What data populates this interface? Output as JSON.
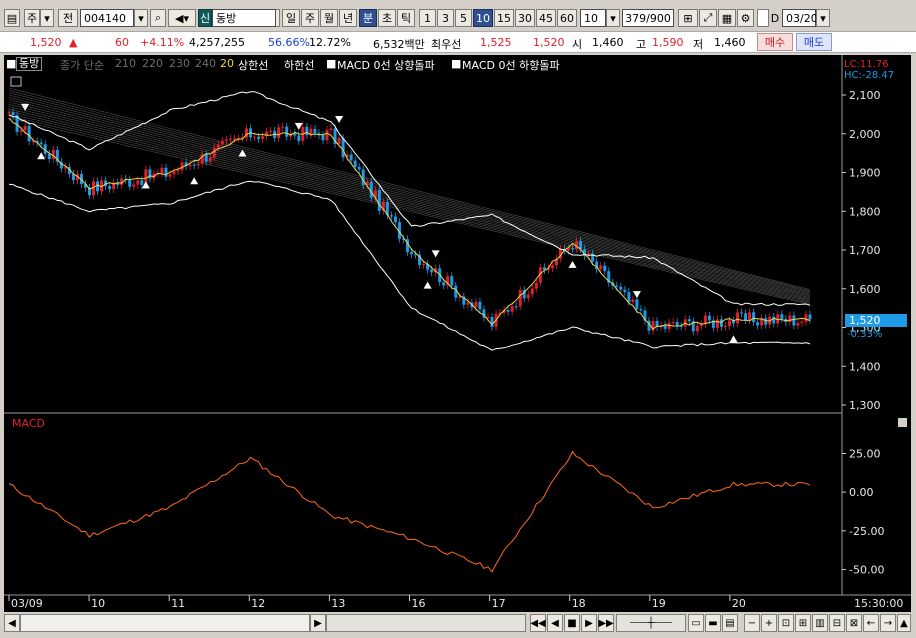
{
  "toolbar": {
    "market": "주",
    "prefix": "전",
    "code": "004140",
    "badge": "신",
    "name": "동방",
    "period_tabs": [
      "일",
      "주",
      "월",
      "년",
      "분",
      "초",
      "틱"
    ],
    "active_period": "분",
    "intervals": [
      "1",
      "3",
      "5",
      "10",
      "15",
      "30",
      "45",
      "60"
    ],
    "active_interval": "10",
    "count_value": "10",
    "page_count": "379/900",
    "date_check_label": "D",
    "date": "03/20"
  },
  "quote": {
    "price": "1,520",
    "arrow": "▲",
    "change": "60",
    "change_pct": "+4.11%",
    "volume": "4,257,255",
    "ratio1": "56.66%",
    "ratio2": "12.72%",
    "amount": "6,532백만",
    "priority_label": "최우선",
    "ask": "1,525",
    "bid": "1,520",
    "open_label": "시",
    "open": "1,460",
    "high_label": "고",
    "high": "1,590",
    "low_label": "저",
    "low": "1,460",
    "buy_label": "매수",
    "sell_label": "매도"
  },
  "legend": {
    "title": "동방",
    "ma_label": "종가 단순",
    "ma_periods": [
      "210",
      "220",
      "230",
      "240"
    ],
    "bb_period": "20",
    "bb_upper": "상한선",
    "bb_lower": "하한선",
    "signal_up": "MACD 0선 상향돌파",
    "signal_down": "MACD 0선 하향돌파",
    "lc": "LC:11.76",
    "hc": "HC:-28.47"
  },
  "price_axis": {
    "ticks": [
      "2,100",
      "2,000",
      "1,900",
      "1,800",
      "1,700",
      "1,600",
      "1,500",
      "1,400",
      "1,300"
    ],
    "current_price": "1,520",
    "current_change": "-0.33%"
  },
  "macd": {
    "title": "MACD",
    "ticks": [
      "25.00",
      "0.00",
      "-25.00",
      "-50.00"
    ]
  },
  "x_axis": {
    "labels": [
      "03/09",
      "10",
      "11",
      "12",
      "13",
      "16",
      "17",
      "18",
      "19",
      "20"
    ],
    "time": "15:30:00"
  },
  "colors": {
    "up": "#e0202a",
    "down": "#1e9be8",
    "bollinger": "#ffffff",
    "ma20": "#e8d84a",
    "macd": "#ff6a1a",
    "grid_ma": "#8a8a8a",
    "price_marker": "#1e9be8"
  },
  "chart_data": {
    "type": "line",
    "x": [
      "03/09",
      "10",
      "11",
      "12",
      "13",
      "16",
      "17",
      "18",
      "19",
      "20"
    ],
    "price_ylim": [
      1300,
      2100
    ],
    "macd_ylim": [
      -60,
      35
    ],
    "x_tick_labels": [
      "03/09",
      "10",
      "11",
      "12",
      "13",
      "16",
      "17",
      "18",
      "19",
      "20"
    ],
    "y_tick_labels": [
      "2,100",
      "2,000",
      "1,900",
      "1,800",
      "1,700",
      "1,600",
      "1,500",
      "1,400",
      "1,300"
    ],
    "macd_tick_labels": [
      "25.00",
      "0.00",
      "-25.00",
      "-50.00"
    ],
    "series": [
      {
        "name": "동방",
        "values": [
          2040,
          1860,
          1900,
          2000,
          2000,
          1700,
          1510,
          1720,
          1500,
          1520
        ]
      },
      {
        "name": "상한선",
        "values": [
          2050,
          1960,
          2060,
          2110,
          2030,
          1760,
          1790,
          1690,
          1680,
          1560
        ]
      },
      {
        "name": "하한선",
        "values": [
          1870,
          1800,
          1820,
          1880,
          1830,
          1550,
          1440,
          1500,
          1450,
          1460
        ]
      },
      {
        "name": "MACD",
        "values": [
          5,
          -28,
          -10,
          22,
          -15,
          -30,
          -50,
          25,
          -10,
          5
        ]
      }
    ]
  }
}
